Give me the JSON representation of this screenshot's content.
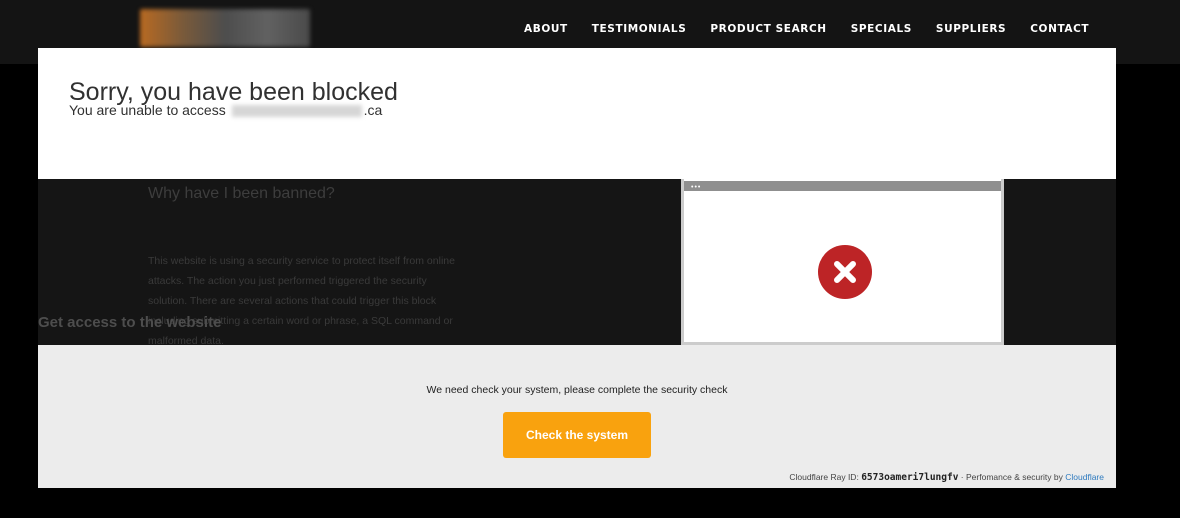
{
  "nav": {
    "items": [
      "ABOUT",
      "TESTIMONIALS",
      "PRODUCT SEARCH",
      "SPECIALS",
      "SUPPLIERS",
      "CONTACT"
    ]
  },
  "block": {
    "title": "Sorry, you have been blocked",
    "subtitle_prefix": "You are unable to access",
    "domain_suffix": ".ca"
  },
  "why": {
    "heading": "Why have I been banned?",
    "text": "This website is using a security service to protect itself from online attacks. The action you just performed triggered the security solution. There are several actions that could trigger this block including submitting a certain word or phrase, a SQL command or malformed data."
  },
  "access": {
    "heading": "Get access to the website",
    "message": "We need check your system, please complete the security check",
    "button_label": "Check the system"
  },
  "footer": {
    "ray_label": "Cloudflare Ray ID:",
    "ray_id": "6573oameri7lungfv",
    "separator": "·",
    "perf_text": "Perfomance & security by",
    "link_text": "Cloudflare"
  },
  "colors": {
    "accent_button": "#f9a20e",
    "error_icon": "#bd2426",
    "link": "#2f7bbf"
  },
  "icons": [
    "error-x-icon",
    "browser-dots-icon"
  ]
}
